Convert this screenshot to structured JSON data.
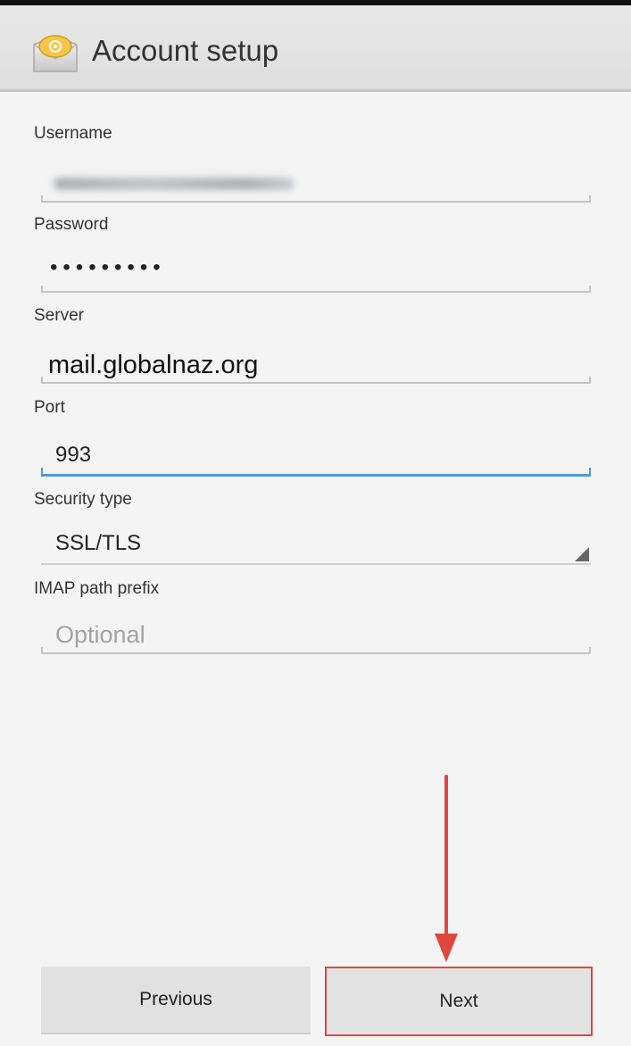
{
  "header": {
    "title": "Account setup",
    "icon": "email-app-icon"
  },
  "form": {
    "username": {
      "label": "Username",
      "value": ""
    },
    "password": {
      "label": "Password",
      "value": "•••••••••"
    },
    "server": {
      "label": "Server",
      "value": "mail.globalnaz.org"
    },
    "port": {
      "label": "Port",
      "value": "993"
    },
    "security": {
      "label": "Security type",
      "value": "SSL/TLS"
    },
    "imap_prefix": {
      "label": "IMAP path prefix",
      "placeholder": "Optional"
    }
  },
  "buttons": {
    "previous": "Previous",
    "next": "Next"
  },
  "colors": {
    "accent": "#4a9bd6",
    "annotation": "#e0463e"
  }
}
